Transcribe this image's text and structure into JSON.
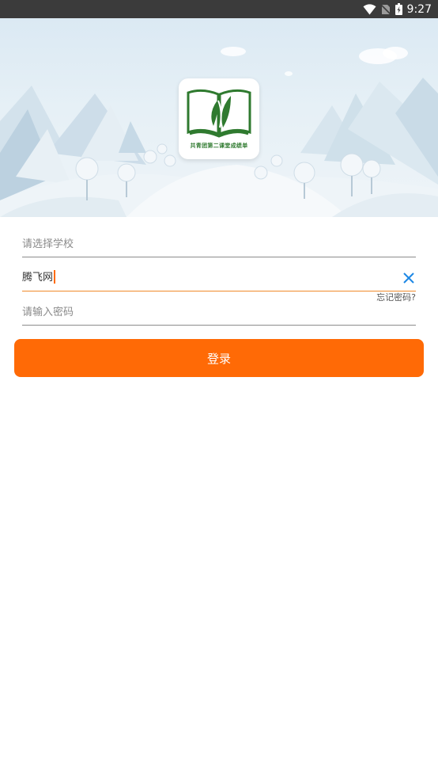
{
  "status_bar": {
    "time": "9:27",
    "icons": [
      "wifi-icon",
      "no-sim-icon",
      "battery-charging-icon"
    ]
  },
  "banner": {
    "logo_caption": "共青团第二课堂成绩单"
  },
  "form": {
    "school_placeholder": "请选择学校",
    "username_value": "腾飞网",
    "password_placeholder": "请输入密码",
    "forgot_password": "忘记密码?"
  },
  "login_button": "登录",
  "colors": {
    "accent": "#ff6a06",
    "clear_icon": "#1e88e5",
    "logo_green": "#2f7a2f"
  }
}
